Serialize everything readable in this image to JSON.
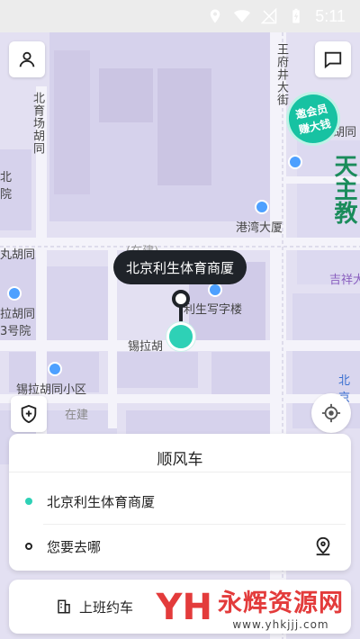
{
  "status": {
    "time": "5:11"
  },
  "map": {
    "labels": {
      "wangfujing": "王府井大街",
      "beiyuchang": "北育场胡同",
      "beiyuan": "北\n院",
      "hutong_left": "丸胡同",
      "hutong_left2": "拉胡同\n3号院",
      "gangwan": "港湾大厦",
      "lisheng_office": "利生写字楼",
      "xila": "锡拉胡",
      "xila_xiaoqu": "锡拉胡同小区",
      "zaijian": "在建",
      "hutong_right": "胡同",
      "tianzhu": "天主教",
      "jixiang": "吉祥大",
      "bei_bank": "北京\n银",
      "construct": "(在建)"
    }
  },
  "badge": {
    "line1": "邀会员",
    "line2": "赚大钱"
  },
  "tooltip": {
    "text": "北京利生体育商厦"
  },
  "card": {
    "title": "顺风车",
    "origin": "北京利生体育商厦",
    "destination_placeholder": "您要去哪",
    "origin_color": "#2ed1b6",
    "dest_color": "#222222"
  },
  "bottom": {
    "label": "上班约车",
    "watermark_main": "永辉资源网",
    "watermark_url": "www.yhkjjj.com"
  },
  "icons": {
    "profile": "profile-icon",
    "message": "message-icon",
    "shield": "shield-icon",
    "locate": "locate-icon",
    "destination": "destination-pin-icon",
    "office": "office-icon"
  }
}
